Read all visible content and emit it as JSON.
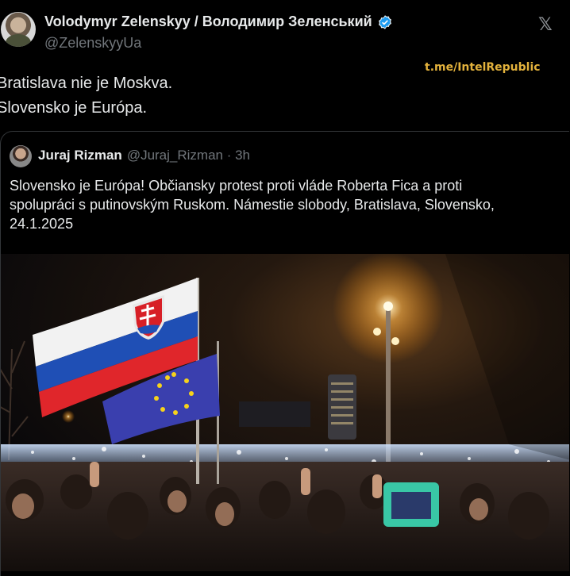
{
  "tweet": {
    "display_name": "Volodymyr Zelenskyy / Володимир Зеленський",
    "handle": "@ZelenskyyUa",
    "lines": [
      "Bratislava nie je Moskva.",
      "Slovensko je Európa."
    ]
  },
  "watermark": "t.me/IntelRepublic",
  "quote": {
    "display_name": "Juraj Rizman",
    "handle_time": "@Juraj_Rizman · 3h",
    "lines": [
      "Slovensko je Európa! Občiansky protest proti vláde Roberta Fica a proti",
      "spolupráci s putinovským Ruskom. Námestie slobody, Bratislava, Slovensko,",
      "24.1.2025"
    ]
  },
  "colors": {
    "background": "#000000",
    "verified": "#1d9bf0",
    "watermark": "#e3b23c",
    "flag_white": "#f2f2f2",
    "flag_blue": "#1f4fb5",
    "flag_red": "#e0262b",
    "eu_blue": "#3a3fae",
    "eu_star": "#f6d21b"
  },
  "icons": [
    "verified-badge-icon",
    "x-logo-icon"
  ]
}
